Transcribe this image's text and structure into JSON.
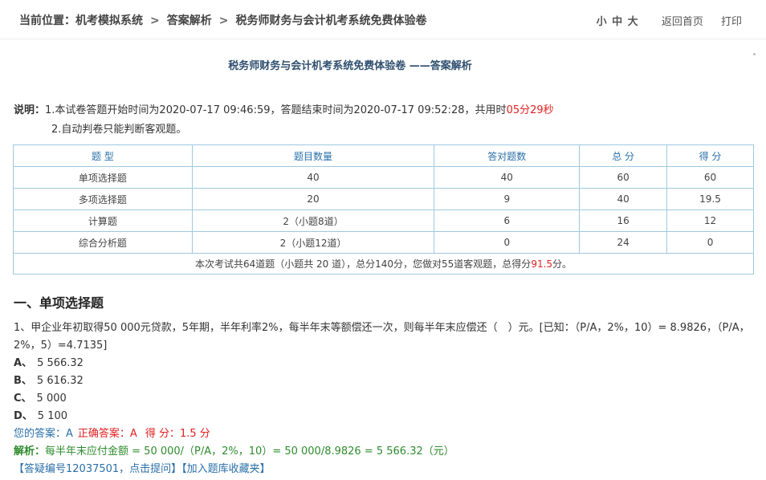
{
  "breadcrumb": {
    "prefix": "当前位置：",
    "items": [
      "机考模拟系统",
      "答案解析",
      "税务师财务与会计机考系统免费体验卷"
    ],
    "separator": ">"
  },
  "top_actions": {
    "font_sizes": "小 中 大",
    "home": "返回首页",
    "print": "打印"
  },
  "page_title": "税务师财务与会计机考系统免费体验卷 ——答案解析",
  "notes": {
    "label": "说明：",
    "line1_prefix": "1.本试卷答题开始时间为2020-07-17 09:46:59，答题结束时间为2020-07-17 09:52:28，共用时",
    "line1_duration": "05分29秒",
    "line2": "2.自动判卷只能判断客观题。"
  },
  "score_table": {
    "headers": [
      "题 型",
      "题目数量",
      "答对题数",
      "总 分",
      "得 分"
    ],
    "rows": [
      [
        "单项选择题",
        "40",
        "40",
        "60",
        "60"
      ],
      [
        "多项选择题",
        "20",
        "9",
        "40",
        "19.5"
      ],
      [
        "计算题",
        "2（小题8道）",
        "6",
        "16",
        "12"
      ],
      [
        "综合分析题",
        "2（小题12道）",
        "0",
        "24",
        "0"
      ]
    ],
    "summary_prefix": "本次考试共64道题（小题共 20 道），总分140分，您做对55道客观题，总得分",
    "summary_score": "91.5",
    "summary_suffix": "分。"
  },
  "section_title": "一、单项选择题",
  "question": {
    "stem": "1、甲企业年初取得50 000元贷款，5年期，半年利率2%，每半年末等额偿还一次，则每半年末应偿还（　）元。[已知：（P/A，2%，10）= 8.9826，（P/A，2%，5）=4.7135]",
    "options": [
      {
        "key": "A、",
        "text": "5 566.32"
      },
      {
        "key": "B、",
        "text": "5 616.32"
      },
      {
        "key": "C、",
        "text": "5 000"
      },
      {
        "key": "D、",
        "text": "5 100"
      }
    ],
    "your_answer": "您的答案：A",
    "correct_answer": "正确答案：A",
    "score": "得 分：1.5  分",
    "explanation_label": "解析：",
    "explanation": "每半年末应付金额 = 50 000/（P/A，2%，10）= 50 000/8.9826 = 5 566.32（元）",
    "link_question": "【答疑编号12037501，点击提问】",
    "link_favorite": "【加入题库收藏夹】"
  },
  "colors": {
    "accent_blue": "#2a6fa8",
    "red": "#e02020",
    "green": "#2e8b2e",
    "table_border": "#9fc8e0"
  }
}
